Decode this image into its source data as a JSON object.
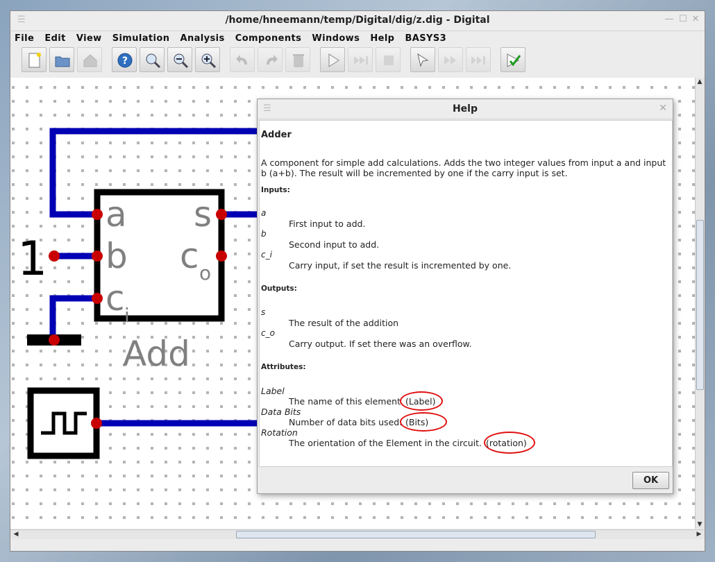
{
  "window": {
    "title": "/home/hneemann/temp/Digital/dig/z.dig - Digital"
  },
  "menu": [
    "File",
    "Edit",
    "View",
    "Simulation",
    "Analysis",
    "Components",
    "Windows",
    "Help",
    "BASYS3"
  ],
  "toolbar": {
    "buttons": [
      "new-file-icon",
      "open-folder-icon",
      "save-icon",
      "help-icon",
      "zoom-fit-icon",
      "zoom-out-icon",
      "zoom-in-icon",
      "undo-icon",
      "redo-icon",
      "delete-icon",
      "run-icon",
      "step-icon",
      "stop-icon",
      "select-pointer-icon",
      "fast-forward-icon",
      "fast-forward-end-icon",
      "check-icon"
    ]
  },
  "circuit": {
    "adder": {
      "label": "Add",
      "inputs": [
        "a",
        "b",
        "c",
        "i"
      ],
      "outputs": [
        "s",
        "c",
        "o"
      ]
    },
    "constant": "1"
  },
  "help": {
    "title": "Help",
    "component": "Adder",
    "description_line1": "A component for simple add calculations. Adds the two integer values from input a and input",
    "description_line2": "b (a+b). The result will be incremented by one if the carry input is set.",
    "inputs_heading": "Inputs:",
    "inputs": [
      {
        "name": "a",
        "desc": "First input to add."
      },
      {
        "name": "b",
        "desc": "Second input to add."
      },
      {
        "name": "c_i",
        "desc": "Carry input, if set the result is incremented by one."
      }
    ],
    "outputs_heading": "Outputs:",
    "outputs": [
      {
        "name": "s",
        "desc": "The result of the addition"
      },
      {
        "name": "c_o",
        "desc": "Carry output. If set there was an overflow."
      }
    ],
    "attributes_heading": "Attributes:",
    "attributes": [
      {
        "name": "Label",
        "desc": "The name of this element.",
        "key": "(Label)"
      },
      {
        "name": "Data Bits",
        "desc": "Number of data bits used.",
        "key": "(Bits)"
      },
      {
        "name": "Rotation",
        "desc": "The orientation of the Element in the circuit.",
        "key": "(rotation)"
      }
    ],
    "ok_label": "OK"
  },
  "colors": {
    "wire": "#0000b4",
    "pin": "#c80000",
    "annotation": "#e01010",
    "background": "#ffffff"
  }
}
